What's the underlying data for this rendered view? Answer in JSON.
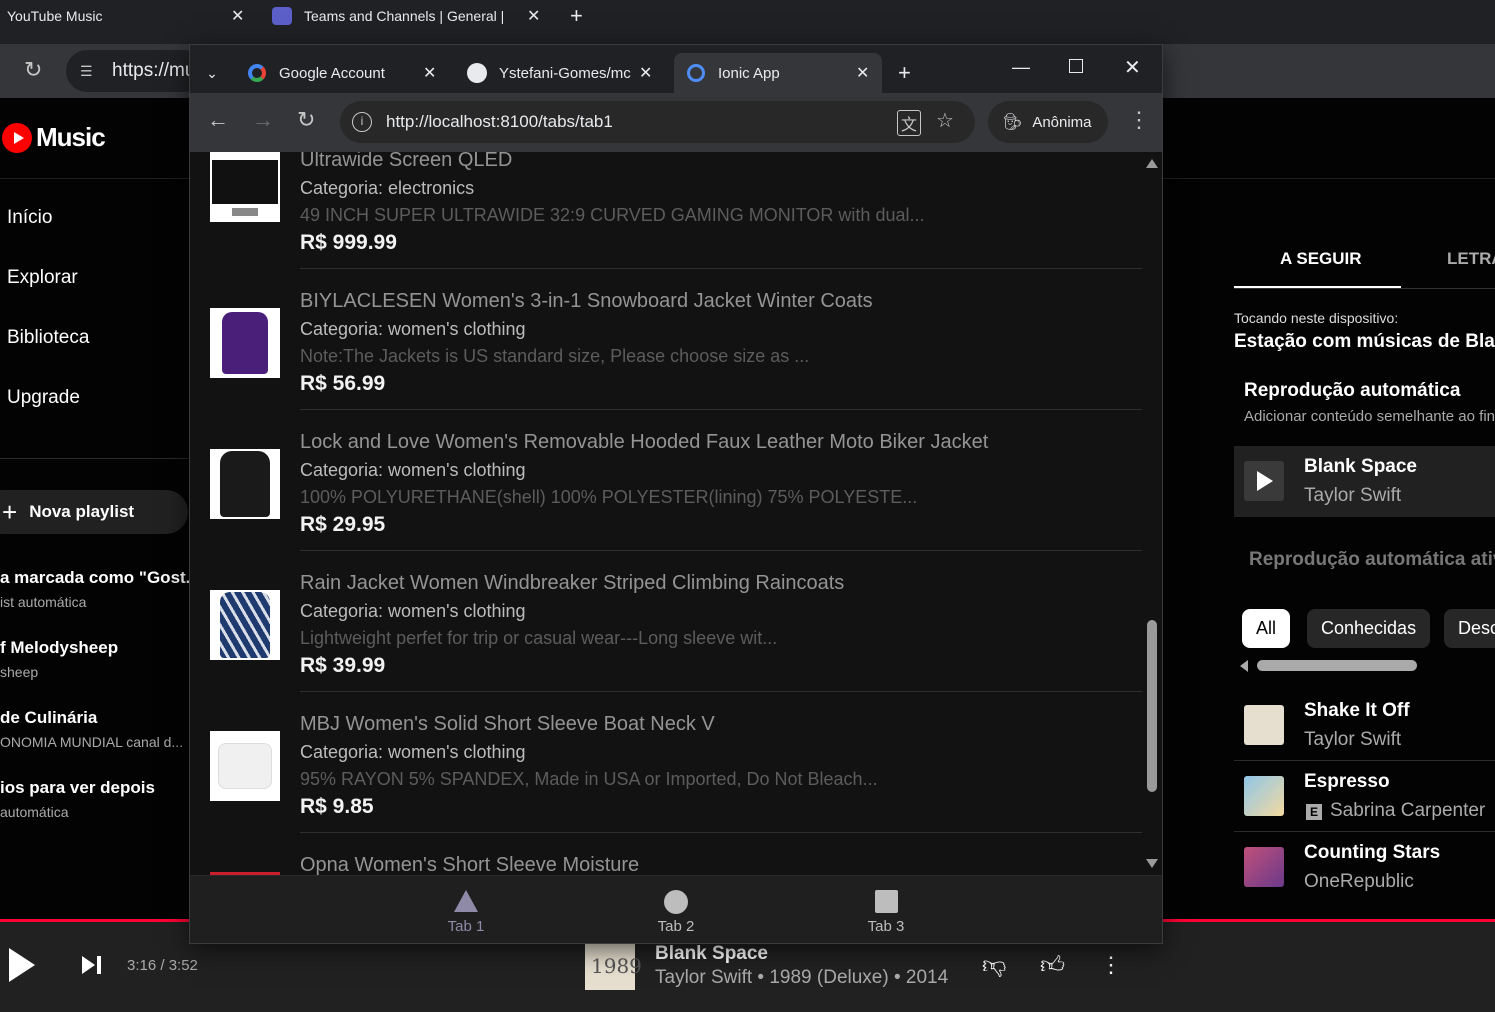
{
  "bg_browser": {
    "tabs": [
      {
        "label": "YouTube Music"
      },
      {
        "label": "Teams and Channels | General |"
      }
    ],
    "url_partial": "https://mu"
  },
  "ytmusic": {
    "logo": "Music",
    "nav": [
      "Início",
      "Explorar",
      "Biblioteca",
      "Upgrade"
    ],
    "new_playlist": "Nova playlist",
    "playlists": [
      {
        "title": "a marcada como \"Gost...",
        "sub": "ist automática"
      },
      {
        "title": "f Melodysheep",
        "sub": "sheep"
      },
      {
        "title": "de Culinária",
        "sub": "ONOMIA MUNDIAL canal d..."
      },
      {
        "title": "ios para ver depois",
        "sub": "automática"
      }
    ],
    "right_panel": {
      "tab_next": "A SEGUIR",
      "tab_lyrics": "LETRA",
      "playing_on": "Tocando neste dispositivo:",
      "station": "Estação com músicas de Blan",
      "autoplay_title": "Reprodução automática",
      "autoplay_sub": "Adicionar conteúdo semelhante ao fin",
      "autoplay_on": "Reprodução automática ativ",
      "current": {
        "title": "Blank Space",
        "artist": "Taylor Swift"
      },
      "chips": [
        "All",
        "Conhecidas",
        "Desc"
      ],
      "queue": [
        {
          "title": "Shake It Off",
          "artist": "Taylor Swift",
          "explicit": false
        },
        {
          "title": "Espresso",
          "artist": "Sabrina Carpenter",
          "explicit": true
        },
        {
          "title": "Counting Stars",
          "artist": "OneRepublic",
          "explicit": false
        }
      ]
    },
    "player": {
      "time": "3:16 / 3:52",
      "title": "Blank Space",
      "subtitle": "Taylor Swift • 1989 (Deluxe) • 2014",
      "progress": 0.8
    }
  },
  "fg_browser": {
    "tabs": [
      {
        "label": "Google Account"
      },
      {
        "label": "Ystefani-Gomes/mc"
      },
      {
        "label": "Ionic App"
      }
    ],
    "url": "http://localhost:8100/tabs/tab1",
    "incognito": "Anônima"
  },
  "app": {
    "products": [
      {
        "name": "Ultrawide Screen QLED",
        "category": "Categoria: electronics",
        "desc": "49 INCH SUPER ULTRAWIDE 32:9 CURVED GAMING MONITOR with dual...",
        "price": "R$ 999.99"
      },
      {
        "name": "BIYLACLESEN Women's 3-in-1 Snowboard Jacket Winter Coats",
        "category": "Categoria: women's clothing",
        "desc": "Note:The Jackets is US standard size, Please choose size as ...",
        "price": "R$ 56.99"
      },
      {
        "name": "Lock and Love Women's Removable Hooded Faux Leather Moto Biker Jacket",
        "category": "Categoria: women's clothing",
        "desc": "100% POLYURETHANE(shell) 100% POLYESTER(lining) 75% POLYESTE...",
        "price": "R$ 29.95"
      },
      {
        "name": "Rain Jacket Women Windbreaker Striped Climbing Raincoats",
        "category": "Categoria: women's clothing",
        "desc": "Lightweight perfet for trip or casual wear---Long sleeve wit...",
        "price": "R$ 39.99"
      },
      {
        "name": "MBJ Women's Solid Short Sleeve Boat Neck V",
        "category": "Categoria: women's clothing",
        "desc": "95% RAYON 5% SPANDEX, Made in USA or Imported, Do Not Bleach...",
        "price": "R$ 9.85"
      },
      {
        "name": "Opna Women's Short Sleeve Moisture",
        "category": "",
        "desc": "",
        "price": ""
      }
    ],
    "tabs": [
      "Tab 1",
      "Tab 2",
      "Tab 3"
    ]
  }
}
